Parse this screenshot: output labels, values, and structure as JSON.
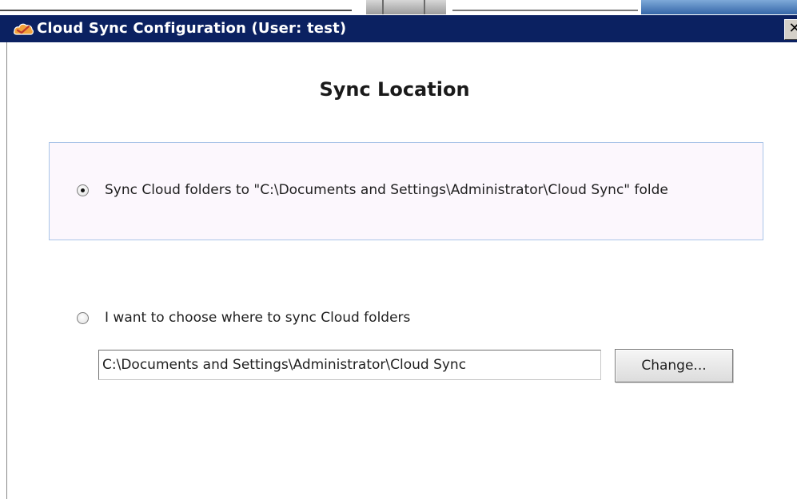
{
  "window": {
    "title": "Cloud Sync Configuration (User: test)",
    "close_glyph": "✕",
    "app_icon": "cloud-sync-app-icon"
  },
  "page": {
    "heading": "Sync Location"
  },
  "options": {
    "default": {
      "label": "Sync Cloud folders to \"C:\\Documents and Settings\\Administrator\\Cloud Sync\" folde",
      "selected": true
    },
    "custom": {
      "label": "I want to choose where to sync Cloud folders",
      "selected": false,
      "path_value": "C:\\Documents and Settings\\Administrator\\Cloud Sync",
      "change_label": "Change..."
    }
  },
  "colors": {
    "titlebar": "#0b2161",
    "panel_background": "#fcf7fd",
    "panel_border": "#a9c4e8"
  }
}
